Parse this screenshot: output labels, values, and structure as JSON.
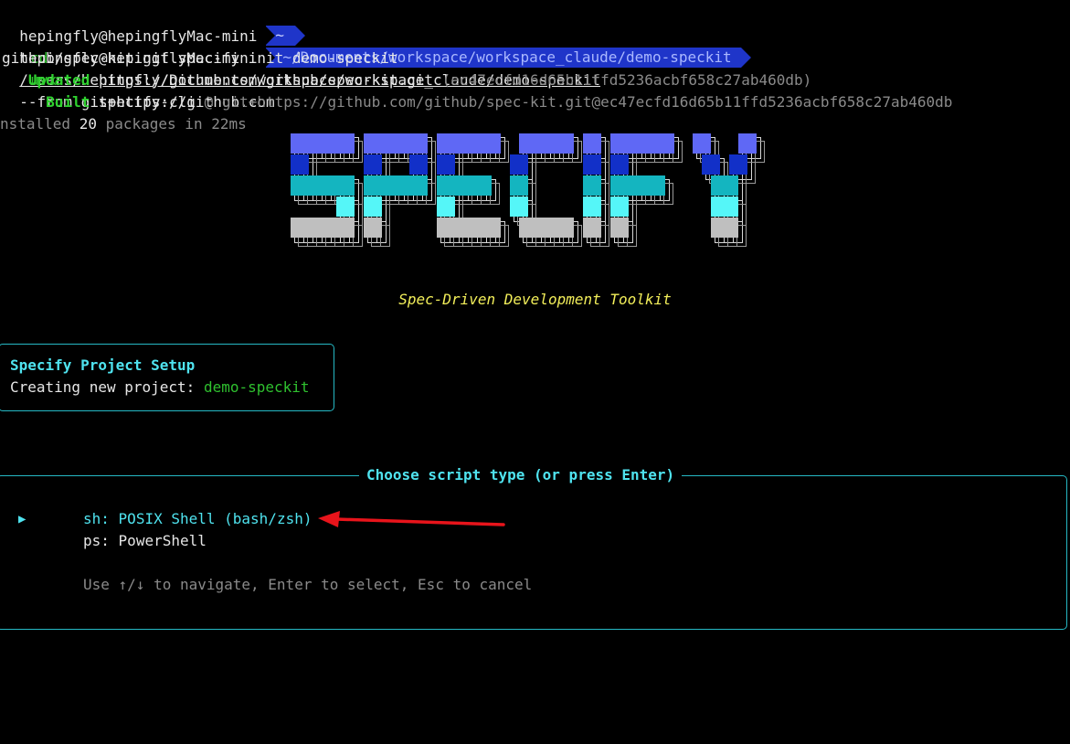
{
  "terminal": {
    "line1": {
      "user_host": "hepingfly@hepingflyMac-mini",
      "cwd": "~",
      "cmd": "cd",
      "arg": "/Users/hepingfly/Documents/workspace/workspace_claude/demo-speckit"
    },
    "line2": {
      "user_host": "hepingfly@hepingflyMac-mini",
      "cwd": "~/Documents/workspace/workspace_claude/demo-speckit",
      "cmd": "uvx",
      "args": "--from git+https://github.com"
    },
    "line3": "github/spec-kit.git specify init demo-speckit",
    "line4": {
      "label": "Updated",
      "url": "https://github.com/github/spec-kit.git",
      "hash": "(ec47ecfd16d65b11ffd5236acbf658c27ab460db)"
    },
    "line5": {
      "label": "Built",
      "pkg": "specify-cli",
      "source": "@ git+https://github.com/github/spec-kit.git@ec47ecfd16d65b11ffd5236acbf658c27ab460db"
    },
    "line6": {
      "prefix": "nstalled",
      "count": "20",
      "suffix": "packages in 22ms"
    }
  },
  "banner": {
    "tagline": "Spec-Driven Development Toolkit"
  },
  "setup_panel": {
    "title": "Specify Project Setup",
    "label": "Creating new project:",
    "project": "demo-speckit"
  },
  "script_panel": {
    "title": "Choose script type (or press Enter)",
    "pointer": "▶",
    "options": [
      {
        "key": "sh:",
        "label": "POSIX Shell (bash/zsh)",
        "selected": true
      },
      {
        "key": "ps:",
        "label": "PowerShell",
        "selected": false
      }
    ],
    "help": "Use ↑/↓ to navigate, Enter to select, Esc to cancel"
  },
  "colors": {
    "background": "#000000",
    "prompt_segment": "#1f35c9",
    "panel_border": "#26b9c5",
    "cyan_text": "#4fe3ef",
    "green_text": "#2fc12f",
    "tagline": "#f3ef5a",
    "annotation_arrow": "#e8141b"
  },
  "icons": [
    "pointer-triangle-icon",
    "annotation-arrow-icon"
  ]
}
